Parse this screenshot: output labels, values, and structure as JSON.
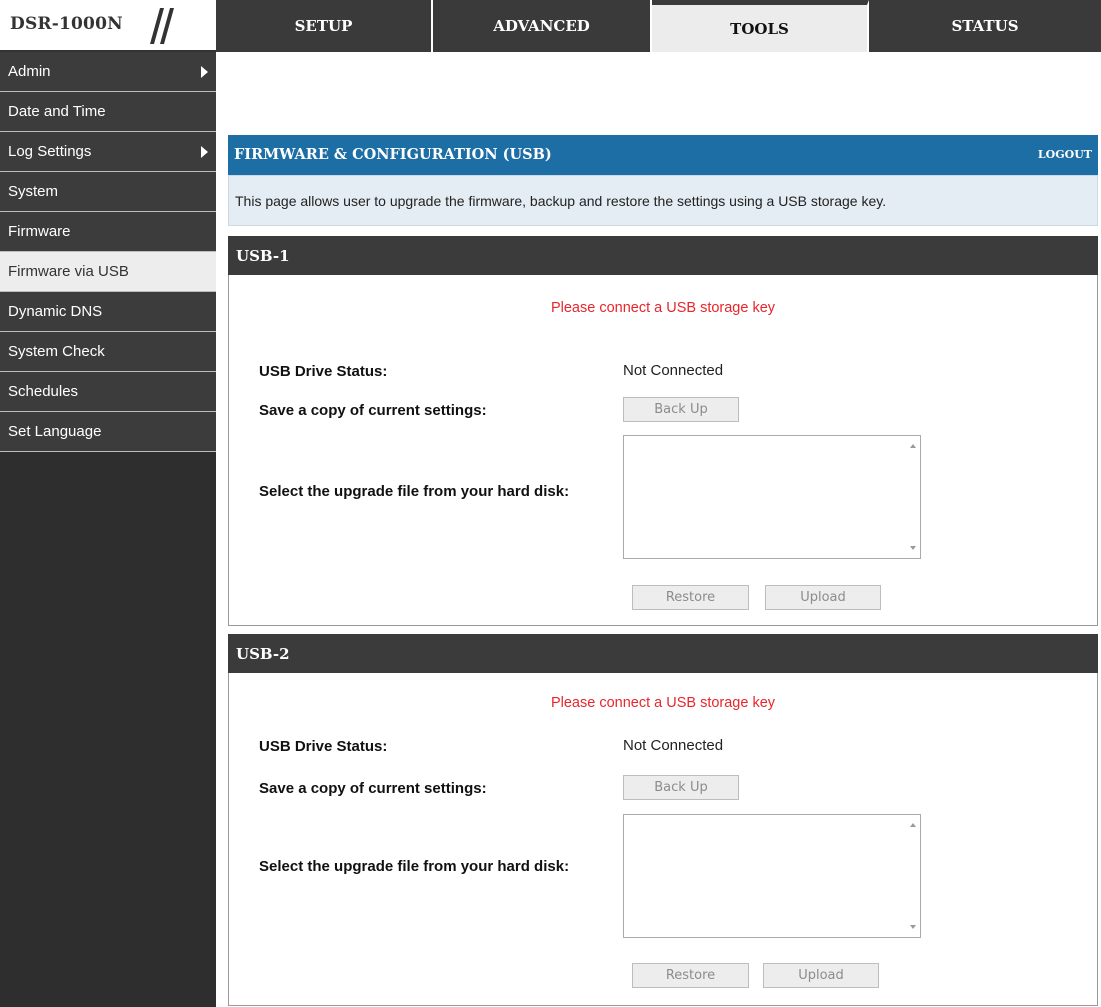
{
  "brand": {
    "model": "DSR-1000N"
  },
  "tabs": [
    {
      "label": "SETUP",
      "active": false
    },
    {
      "label": "ADVANCED",
      "active": false
    },
    {
      "label": "TOOLS",
      "active": true
    },
    {
      "label": "STATUS",
      "active": false
    }
  ],
  "sidebar": {
    "items": [
      {
        "label": "Admin",
        "has_submenu": true,
        "active": false
      },
      {
        "label": "Date and Time",
        "has_submenu": false,
        "active": false
      },
      {
        "label": "Log Settings",
        "has_submenu": true,
        "active": false
      },
      {
        "label": "System",
        "has_submenu": false,
        "active": false
      },
      {
        "label": "Firmware",
        "has_submenu": false,
        "active": false
      },
      {
        "label": "Firmware via USB",
        "has_submenu": false,
        "active": true
      },
      {
        "label": "Dynamic DNS",
        "has_submenu": false,
        "active": false
      },
      {
        "label": "System Check",
        "has_submenu": false,
        "active": false
      },
      {
        "label": "Schedules",
        "has_submenu": false,
        "active": false
      },
      {
        "label": "Set Language",
        "has_submenu": false,
        "active": false
      }
    ]
  },
  "page": {
    "title": "FIRMWARE & CONFIGURATION (USB)",
    "logout": "LOGOUT",
    "description": "This page allows user to upgrade the firmware, backup and restore the settings using a USB storage key."
  },
  "usb_sections": [
    {
      "title": "USB-1",
      "warning": "Please connect a USB storage key",
      "status_label": "USB Drive Status:",
      "status_value": "Not Connected",
      "backup_label": "Save a copy of current settings:",
      "backup_button": "Back Up",
      "upgrade_label": "Select the upgrade file from your hard disk:",
      "restore_button": "Restore",
      "upload_button": "Upload"
    },
    {
      "title": "USB-2",
      "warning": "Please connect a USB storage key",
      "status_label": "USB Drive Status:",
      "status_value": "Not Connected",
      "backup_label": "Save a copy of current settings:",
      "backup_button": "Back Up",
      "upgrade_label": "Select the upgrade file from your hard disk:",
      "restore_button": "Restore",
      "upload_button": "Upload"
    }
  ],
  "colors": {
    "header_blue": "#1e6ea6",
    "dark_bar": "#3b3b3b",
    "warning_red": "#e8262c",
    "active_tab": "#ececec"
  }
}
